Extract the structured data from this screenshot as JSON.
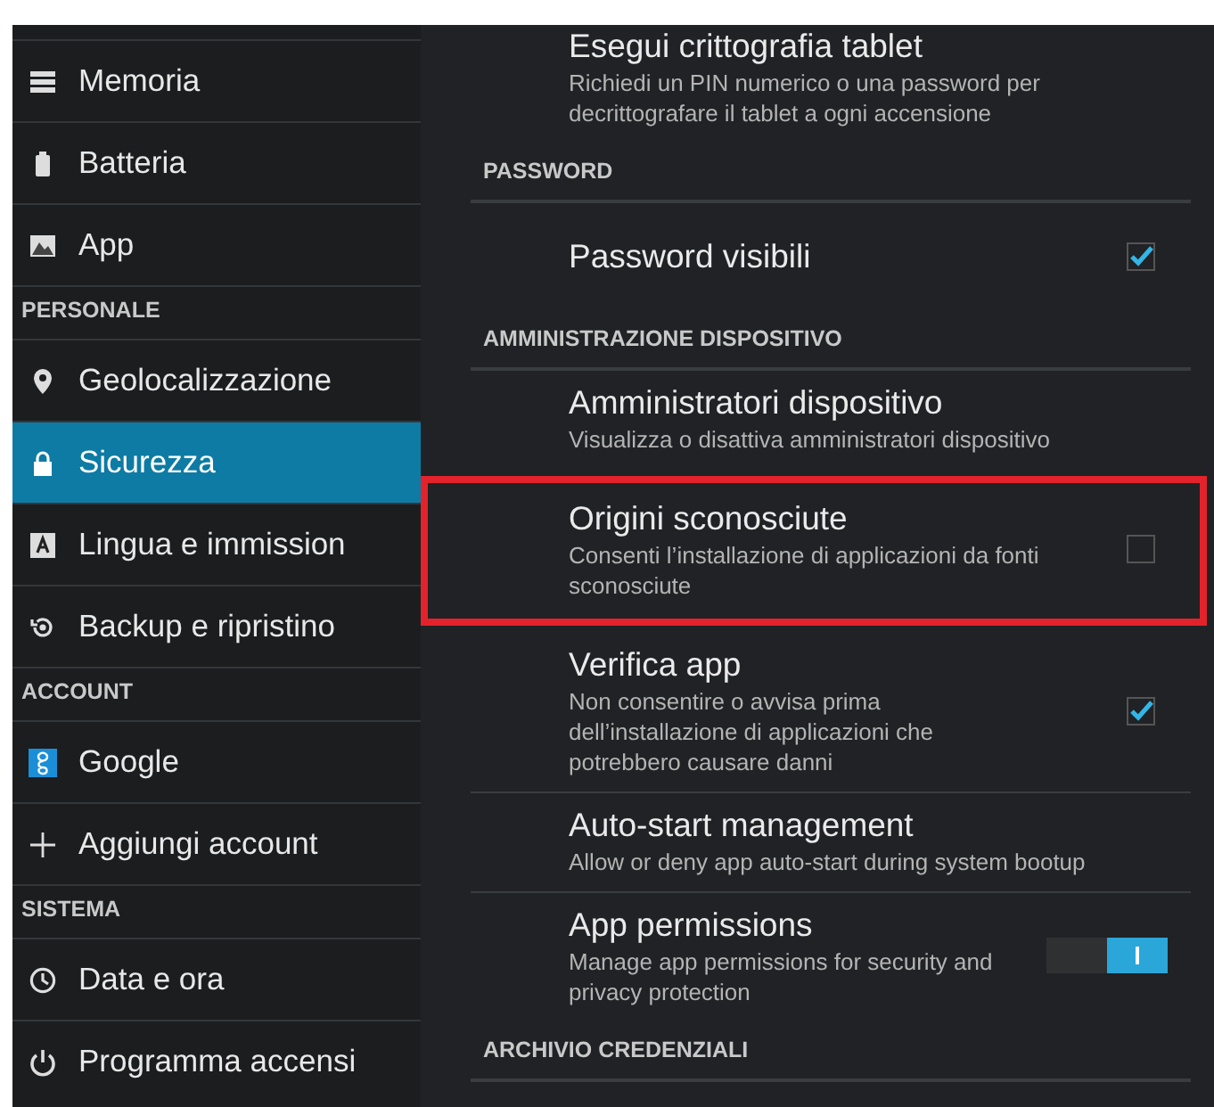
{
  "sidebar": {
    "items": [
      {
        "kind": "item",
        "label": "Memoria",
        "selected": false
      },
      {
        "kind": "item",
        "label": "Batteria",
        "selected": false
      },
      {
        "kind": "item",
        "label": "App",
        "selected": false
      },
      {
        "kind": "header",
        "label": "PERSONALE"
      },
      {
        "kind": "item",
        "label": "Geolocalizzazione",
        "selected": false
      },
      {
        "kind": "item",
        "label": "Sicurezza",
        "selected": true
      },
      {
        "kind": "item",
        "label": "Lingua e immission",
        "selected": false
      },
      {
        "kind": "item",
        "label": "Backup e ripristino",
        "selected": false
      },
      {
        "kind": "header",
        "label": "ACCOUNT"
      },
      {
        "kind": "item",
        "label": "Google",
        "selected": false
      },
      {
        "kind": "item",
        "label": "Aggiungi account",
        "selected": false
      },
      {
        "kind": "header",
        "label": "SISTEMA"
      },
      {
        "kind": "item",
        "label": "Data e ora",
        "selected": false
      },
      {
        "kind": "item",
        "label": "Programma accensi",
        "selected": false
      }
    ]
  },
  "settings": {
    "items": [
      {
        "kind": "plain",
        "title": "Esegui crittografia tablet",
        "summary": "Richiedi un PIN numerico o una password per decrittografare il tablet a ogni accensione"
      },
      {
        "kind": "header",
        "title": "PASSWORD"
      },
      {
        "kind": "checkbox",
        "title": "Password visibili",
        "checked": true
      },
      {
        "kind": "header",
        "title": "AMMINISTRAZIONE DISPOSITIVO"
      },
      {
        "kind": "plain",
        "title": "Amministratori dispositivo",
        "summary": "Visualizza o disattiva amministratori dispositivo"
      },
      {
        "kind": "checkbox",
        "title": "Origini sconosciute",
        "summary": "Consenti l’installazione di applicazioni da fonti sconosciute",
        "checked": false,
        "highlighted": true
      },
      {
        "kind": "checkbox",
        "title": "Verifica app",
        "summary": "Non consentire o avvisa prima dell’installazione di applicazioni che potrebbero causare danni",
        "checked": true
      },
      {
        "kind": "plain",
        "title": "Auto-start management",
        "summary": "Allow or deny app auto-start during system bootup"
      },
      {
        "kind": "switch",
        "title": "App permissions",
        "summary": "Manage app permissions for security and privacy protection",
        "on": true
      },
      {
        "kind": "header",
        "title": "ARCHIVIO CREDENZIALI"
      }
    ]
  }
}
